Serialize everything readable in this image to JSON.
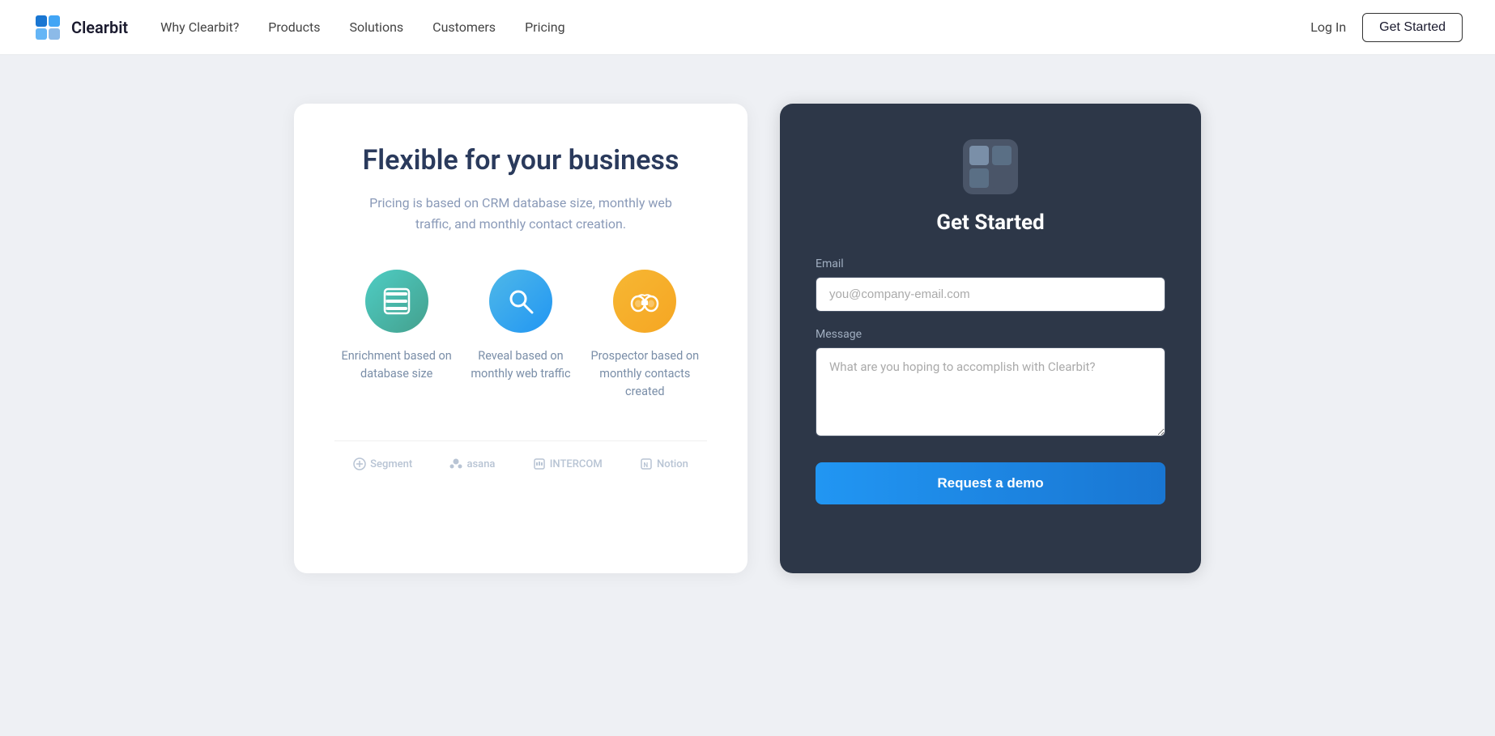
{
  "navbar": {
    "logo_text": "Clearbit",
    "links": [
      {
        "label": "Why Clearbit?",
        "id": "why-clearbit"
      },
      {
        "label": "Products",
        "id": "products"
      },
      {
        "label": "Solutions",
        "id": "solutions"
      },
      {
        "label": "Customers",
        "id": "customers"
      },
      {
        "label": "Pricing",
        "id": "pricing"
      }
    ],
    "login_label": "Log In",
    "get_started_label": "Get Started"
  },
  "left_card": {
    "title": "Flexible for your business",
    "subtitle": "Pricing is based on CRM database size, monthly web traffic, and monthly contact creation.",
    "features": [
      {
        "id": "enrichment",
        "label": "Enrichment based on database size",
        "icon_type": "list",
        "icon_color": "green"
      },
      {
        "id": "reveal",
        "label": "Reveal based on monthly web traffic",
        "icon_type": "search",
        "icon_color": "blue"
      },
      {
        "id": "prospector",
        "label": "Prospector based on monthly contacts created",
        "icon_type": "binoculars",
        "icon_color": "orange"
      }
    ],
    "partners": [
      {
        "label": "Segment",
        "id": "segment"
      },
      {
        "label": "asana",
        "id": "asana"
      },
      {
        "label": "INTERCOM",
        "id": "intercom"
      },
      {
        "label": "Notion",
        "id": "notion"
      }
    ]
  },
  "right_card": {
    "title": "Get Started",
    "email_label": "Email",
    "email_placeholder": "you@company-email.com",
    "message_label": "Message",
    "message_placeholder": "What are you hoping to accomplish with Clearbit?",
    "button_label": "Request a demo"
  }
}
